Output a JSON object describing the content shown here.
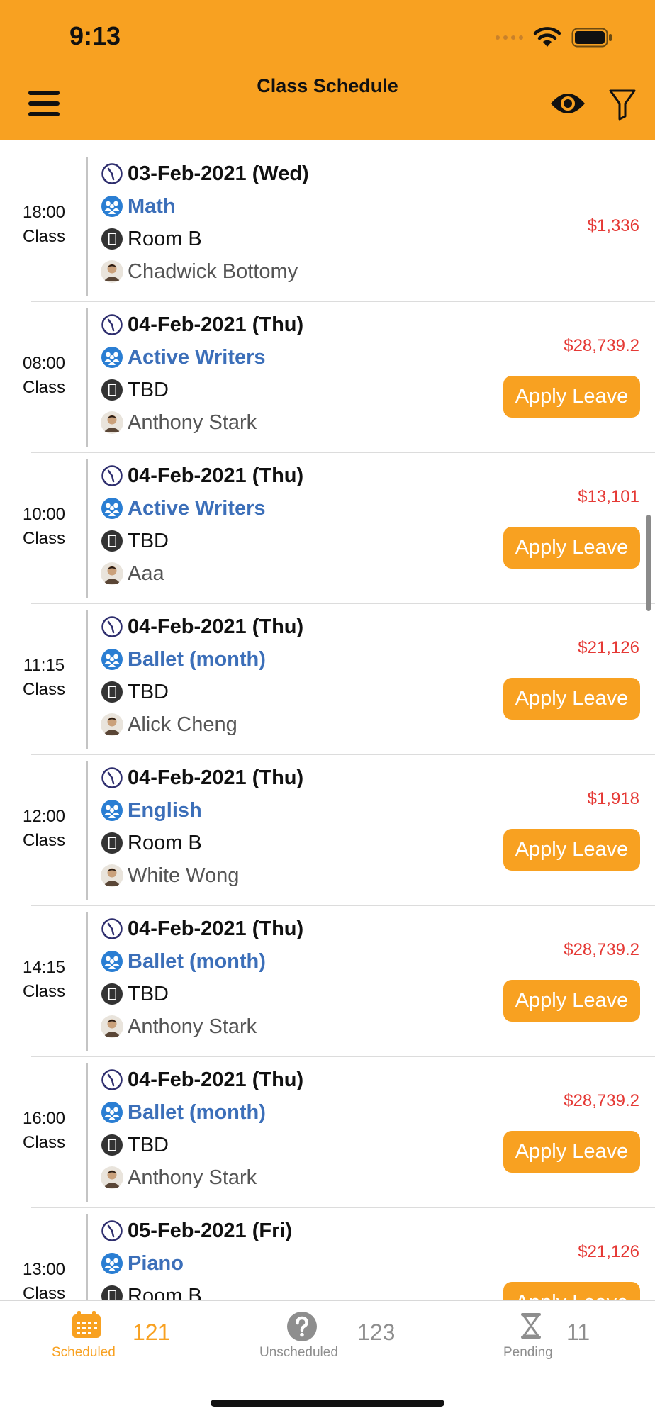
{
  "status_bar": {
    "time": "9:13"
  },
  "header": {
    "title": "Class Schedule"
  },
  "schedule": [
    {
      "time": "18:00",
      "type": "Class",
      "date": "03-Feb-2021 (Wed)",
      "course": "Math",
      "room": "Room B",
      "teacher": "Chadwick Bottomy",
      "price": "$1,336",
      "leave_label": ""
    },
    {
      "time": "08:00",
      "type": "Class",
      "date": "04-Feb-2021 (Thu)",
      "course": "Active Writers",
      "room": "TBD",
      "teacher": "Anthony Stark",
      "price": "$28,739.2",
      "leave_label": "Apply Leave"
    },
    {
      "time": "10:00",
      "type": "Class",
      "date": "04-Feb-2021 (Thu)",
      "course": "Active Writers",
      "room": "TBD",
      "teacher": "Aaa",
      "price": "$13,101",
      "leave_label": "Apply Leave"
    },
    {
      "time": "11:15",
      "type": "Class",
      "date": "04-Feb-2021 (Thu)",
      "course": "Ballet (month)",
      "room": "TBD",
      "teacher": "Alick Cheng",
      "price": "$21,126",
      "leave_label": "Apply Leave"
    },
    {
      "time": "12:00",
      "type": "Class",
      "date": "04-Feb-2021 (Thu)",
      "course": "English",
      "room": "Room B",
      "teacher": "White Wong",
      "price": "$1,918",
      "leave_label": "Apply Leave"
    },
    {
      "time": "14:15",
      "type": "Class",
      "date": "04-Feb-2021 (Thu)",
      "course": "Ballet (month)",
      "room": "TBD",
      "teacher": "Anthony Stark",
      "price": "$28,739.2",
      "leave_label": "Apply Leave"
    },
    {
      "time": "16:00",
      "type": "Class",
      "date": "04-Feb-2021 (Thu)",
      "course": "Ballet (month)",
      "room": "TBD",
      "teacher": "Anthony Stark",
      "price": "$28,739.2",
      "leave_label": "Apply Leave"
    },
    {
      "time": "13:00",
      "type": "Class",
      "date": "05-Feb-2021 (Fri)",
      "course": "Piano",
      "room": "Room B",
      "teacher": "",
      "price": "$21,126",
      "leave_label": "Apply Leave"
    }
  ],
  "tabs": [
    {
      "label": "Scheduled",
      "count": "121",
      "icon": "calendar-icon",
      "active": true
    },
    {
      "label": "Unscheduled",
      "count": "123",
      "icon": "question-icon",
      "active": false
    },
    {
      "label": "Pending",
      "count": "11",
      "icon": "hourglass-icon",
      "active": false
    }
  ],
  "colors": {
    "accent": "#f8a121",
    "course": "#3c6fb9",
    "price": "#e53935",
    "inactive": "#8e8e8e"
  }
}
